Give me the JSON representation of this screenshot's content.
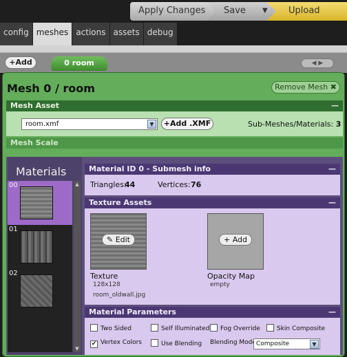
{
  "toolbar": {
    "apply": "Apply Changes",
    "save": "Save",
    "dropdown": "▼",
    "upload": "Upload"
  },
  "tabs": [
    "config",
    "meshes",
    "actions",
    "assets",
    "debug"
  ],
  "subbar": {
    "add": "+Add",
    "room_tab": "0 room",
    "arrows": "◀ ▶"
  },
  "mesh": {
    "title": "Mesh 0 / room",
    "remove": "Remove Mesh ✖",
    "asset_header": "Mesh Asset",
    "minus": "—",
    "file_value": "room.xmf",
    "add_xmf": "+Add .XMF",
    "submesh_label": "Sub-Meshes/Materials:",
    "submesh_count": "3",
    "scale_header": "Mesh Scale"
  },
  "materials": {
    "heading": "Materials",
    "items": [
      {
        "num": "00"
      },
      {
        "num": "01"
      },
      {
        "num": "02"
      }
    ]
  },
  "submesh": {
    "header": "Material ID 0 - Submesh info",
    "tri_label": "Triangles:",
    "tri_value": "44",
    "vert_label": "Vertices:",
    "vert_value": "76"
  },
  "textures": {
    "header": "Texture Assets",
    "texture": {
      "button": "✎ Edit",
      "caption": "Texture",
      "size": "128x128",
      "file": "room_oldwall.jpg"
    },
    "opacity": {
      "button": "+ Add",
      "caption": "Opacity Map",
      "status": "empty"
    }
  },
  "params": {
    "header": "Material Parameters",
    "two_sided": "Two Sided",
    "self_illum": "Self Illuminated",
    "fog": "Fog Override",
    "skin": "Skin Composite",
    "vertex_colors": "Vertex Colors",
    "use_blending": "Use Blending",
    "blend_label": "Blending Mode",
    "blend_value": "Composite",
    "checked": "✔"
  }
}
